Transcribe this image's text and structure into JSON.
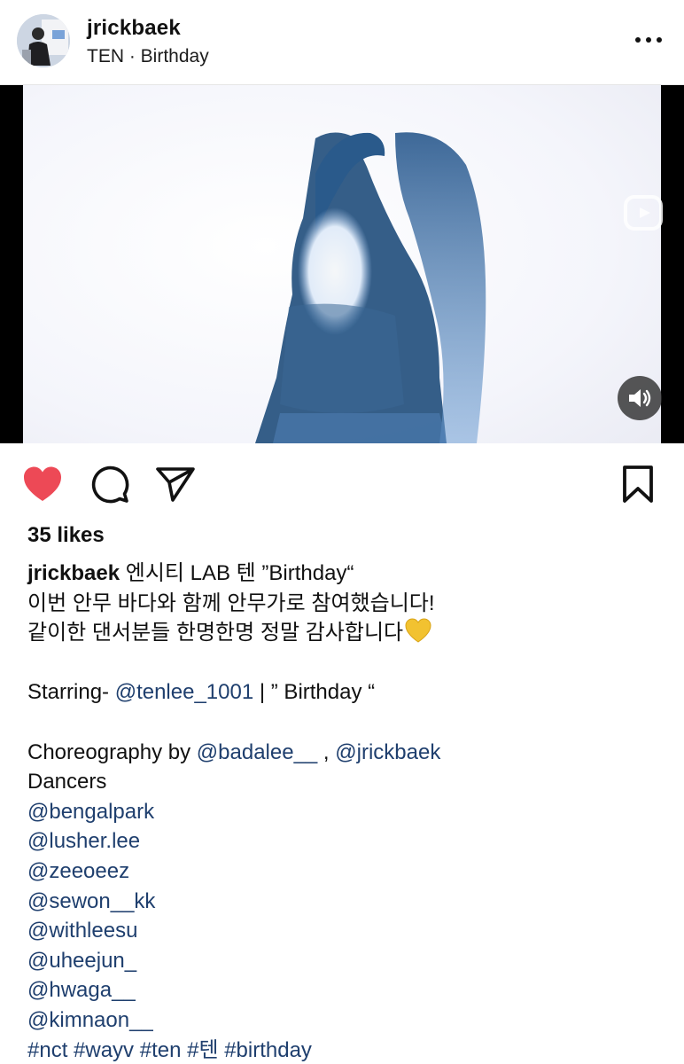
{
  "post": {
    "username": "jrickbaek",
    "subtitle": "TEN · Birthday"
  },
  "actions": {
    "like_icon": "heart-filled-icon",
    "comment_icon": "comment-icon",
    "share_icon": "send-icon",
    "save_icon": "bookmark-icon",
    "like_color": "#ed4956"
  },
  "likes_text": "35 likes",
  "caption": {
    "username": "jrickbaek",
    "line1_text": " 엔시티 LAB 텐 ”Birthday“",
    "line2": "이번 안무 바다와 함께 안무가로 참여했습니다!",
    "line3": "같이한 댄서분들 한명한명 정말 감사합니다",
    "starring_prefix": "Starring- ",
    "starring_mention": "@tenlee_1001",
    "starring_suffix": " | ” Birthday “",
    "choreo_prefix": "Choreography by ",
    "choreo_mention1": "@badalee__",
    "choreo_sep": " , ",
    "choreo_mention2": "@jrickbaek",
    "dancers_label": "Dancers",
    "dancers": [
      "@bengalpark",
      "@lusher.lee",
      "@zeeoeez",
      "@sewon__kk",
      "@withleesu",
      "@uheejun_",
      "@hwaga__",
      "@kimnaon__"
    ],
    "hashtags": "#nct #wayv #ten #텐 #birthday"
  },
  "colors": {
    "link": "#1f3f6e",
    "emoji_heart": "#f2c230"
  }
}
